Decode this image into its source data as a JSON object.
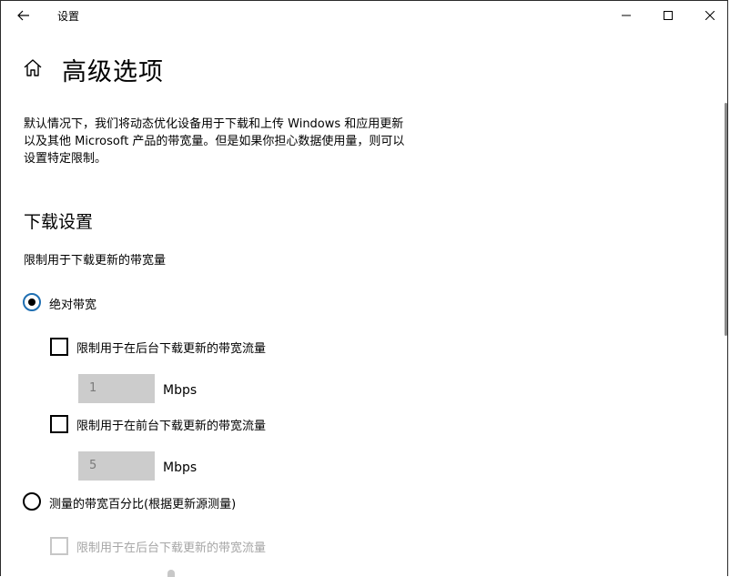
{
  "titlebar": {
    "app_title": "设置",
    "back_icon": "arrow-left-icon",
    "minimize_icon": "minimize-icon",
    "maximize_icon": "maximize-icon",
    "close_icon": "close-icon"
  },
  "header": {
    "home_icon": "home-icon",
    "title": "高级选项"
  },
  "description": {
    "line1": "默认情况下，我们将动态优化设备用于下载和上传 Windows 和应用更新",
    "line2": "以及其他 Microsoft 产品的带宽量。但是如果你担心数据使用量，则可以",
    "line3": "设置特定限制。"
  },
  "download": {
    "section_title": "下载设置",
    "limit_label": "限制用于下载更新的带宽量",
    "absolute": {
      "label": "绝对带宽",
      "selected": true,
      "background": {
        "label": "限制用于在后台下载更新的带宽流量",
        "checked": false,
        "value": "1",
        "unit": "Mbps"
      },
      "foreground": {
        "label": "限制用于在前台下载更新的带宽流量",
        "checked": false,
        "value": "5",
        "unit": "Mbps"
      }
    },
    "percentage": {
      "label": "测量的带宽百分比(根据更新源测量)",
      "selected": false,
      "background": {
        "label": "限制用于在后台下载更新的带宽流量",
        "checked": false,
        "disabled": true
      }
    }
  },
  "colors": {
    "accent": "#1f6fb2",
    "input_bg": "#cccccc",
    "disabled_text": "#a6a6a6"
  }
}
